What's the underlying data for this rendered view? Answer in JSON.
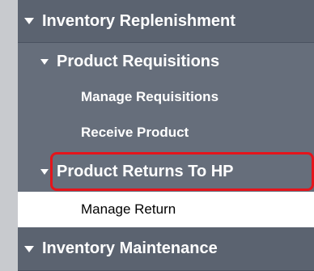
{
  "nav": {
    "inventory_replenishment": "Inventory Replenishment",
    "product_requisitions": "Product Requisitions",
    "manage_requisitions": "Manage Requisitions",
    "receive_product": "Receive Product",
    "product_returns_to_hp": "Product Returns To HP",
    "manage_return": "Manage Return",
    "inventory_maintenance": "Inventory Maintenance"
  },
  "colors": {
    "nav_bg": "#666e7b",
    "header_bg": "#5b6370",
    "selected_bg": "#ffffff",
    "highlight_border": "#e5141b"
  }
}
